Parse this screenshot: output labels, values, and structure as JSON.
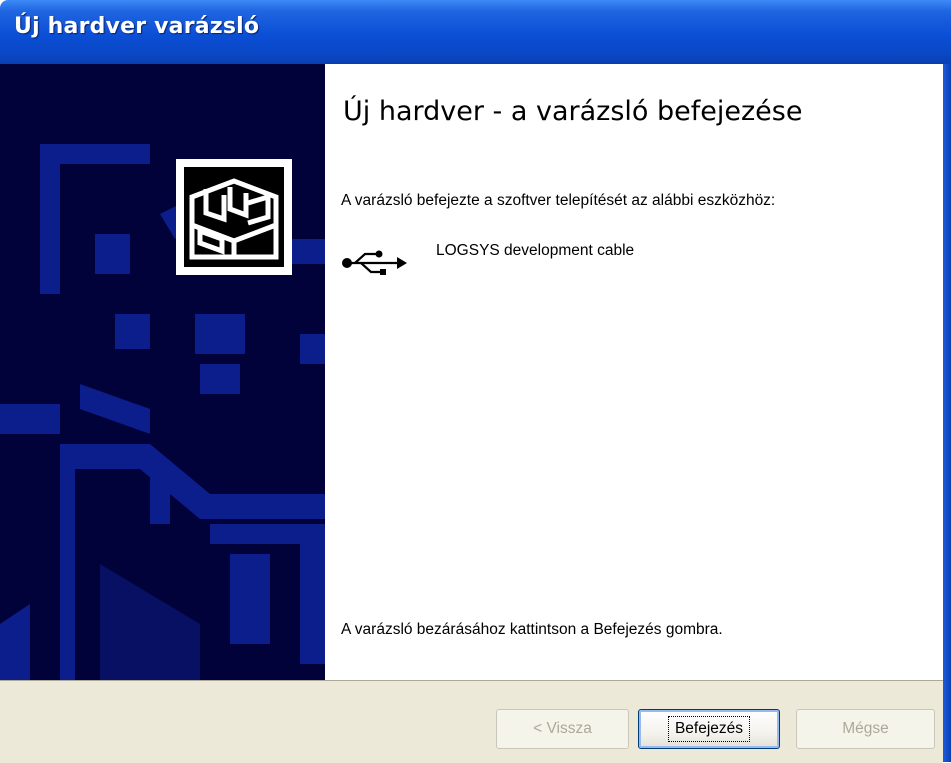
{
  "window": {
    "title": "Új hardver varázsló"
  },
  "wizard": {
    "heading": "Új hardver - a varázsló befejezése",
    "intro_text": "A varázsló befejezte a szoftver telepítését az alábbi eszközhöz:",
    "device_name": "LOGSYS development cable",
    "device_icon": "usb-icon",
    "close_hint": "A varázsló bezárásához kattintson a Befejezés gombra."
  },
  "buttons": {
    "back": "< Vissza",
    "finish": "Befejezés",
    "cancel": "Mégse"
  },
  "icons": {
    "banner_icon": "hardware-icon"
  },
  "colors": {
    "titlebar": "#0a47c4",
    "banner": "#02023a",
    "footer": "#ece9d8"
  }
}
